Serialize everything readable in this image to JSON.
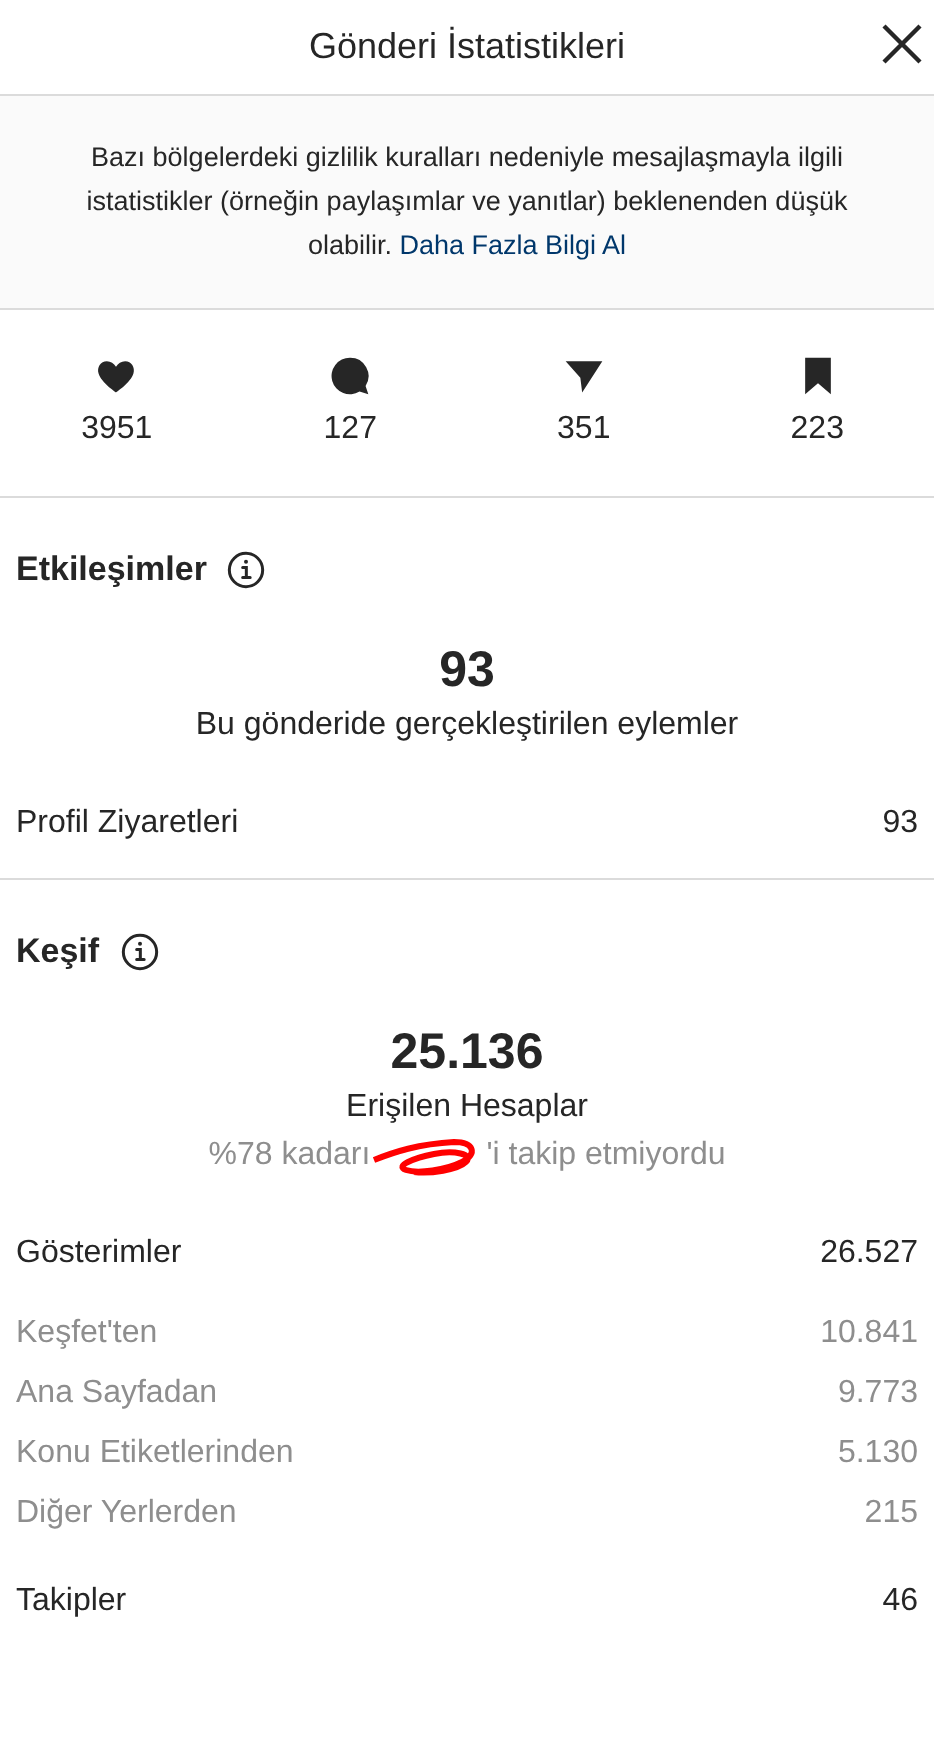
{
  "header": {
    "title": "Gönderi İstatistikleri"
  },
  "notice": {
    "text": "Bazı bölgelerdeki gizlilik kuralları nedeniyle mesajlaşmayla ilgili istatistikler (örneğin paylaşımlar ve yanıtlar) beklenenden düşük olabilir.",
    "link": "Daha Fazla Bilgi Al"
  },
  "stats": [
    {
      "kind": "likes",
      "value": "3951"
    },
    {
      "kind": "comments",
      "value": "127"
    },
    {
      "kind": "shares",
      "value": "351"
    },
    {
      "kind": "saves",
      "value": "223"
    }
  ],
  "sections": [
    {
      "title": "Etkileşimler",
      "big": "93",
      "caption": "Bu gönderide gerçekleştirilen eylemler",
      "rows": [
        {
          "kind": "main",
          "label": "Profil Ziyaretleri",
          "value": "93"
        }
      ]
    },
    {
      "title": "Keşif",
      "big": "25.136",
      "caption": "Erişilen Hesaplar",
      "note_start": "%78 kadarı",
      "note_end": "'i takip etmiyordu",
      "rows": [
        {
          "kind": "main",
          "label": "Gösterimler",
          "value": "26.527"
        },
        {
          "kind": "sub",
          "label": "Keşfet'ten",
          "value": "10.841"
        },
        {
          "kind": "sub",
          "label": "Ana Sayfadan",
          "value": "9.773"
        },
        {
          "kind": "sub",
          "label": "Konu Etiketlerinden",
          "value": "5.130"
        },
        {
          "kind": "sub",
          "label": "Diğer Yerlerden",
          "value": "215"
        },
        {
          "kind": "main",
          "label": "Takipler",
          "value": "46"
        }
      ]
    }
  ]
}
